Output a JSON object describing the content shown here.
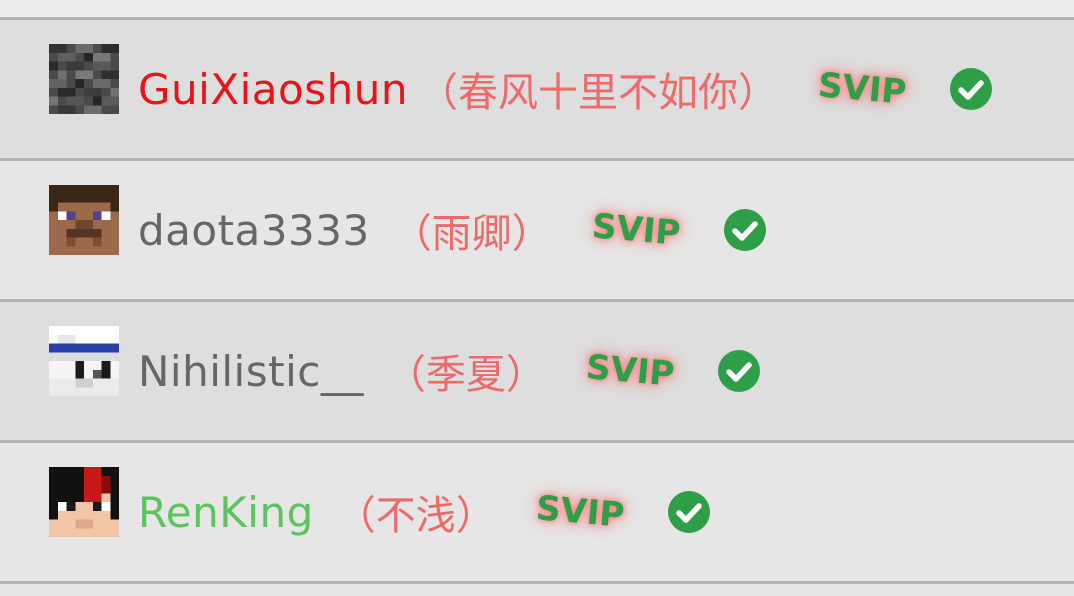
{
  "users": [
    {
      "username": "GuiXiaoshun",
      "nickname": "（春风十里不如你）",
      "badge": "SVIP",
      "name_color": "#e8141a",
      "avatar_icon": "stone-block-avatar-icon",
      "verified_icon": "check-circle-icon"
    },
    {
      "username": "daota3333",
      "nickname": "（雨卿）",
      "badge": "SVIP",
      "name_color": "#666666",
      "avatar_icon": "steve-face-avatar-icon",
      "verified_icon": "check-circle-icon"
    },
    {
      "username": "Nihilistic__",
      "nickname": "（季夏）",
      "badge": "SVIP",
      "name_color": "#666666",
      "avatar_icon": "white-headband-avatar-icon",
      "verified_icon": "check-circle-icon"
    },
    {
      "username": "RenKing",
      "nickname": "（不浅）",
      "badge": "SVIP",
      "name_color": "#5cc45c",
      "avatar_icon": "red-black-hair-avatar-icon",
      "verified_icon": "check-circle-icon"
    }
  ],
  "colors": {
    "nickname": "#ee6a6a",
    "badge": "#2e9e47",
    "check": "#2e9e47",
    "divider": "#b3b3b3"
  }
}
